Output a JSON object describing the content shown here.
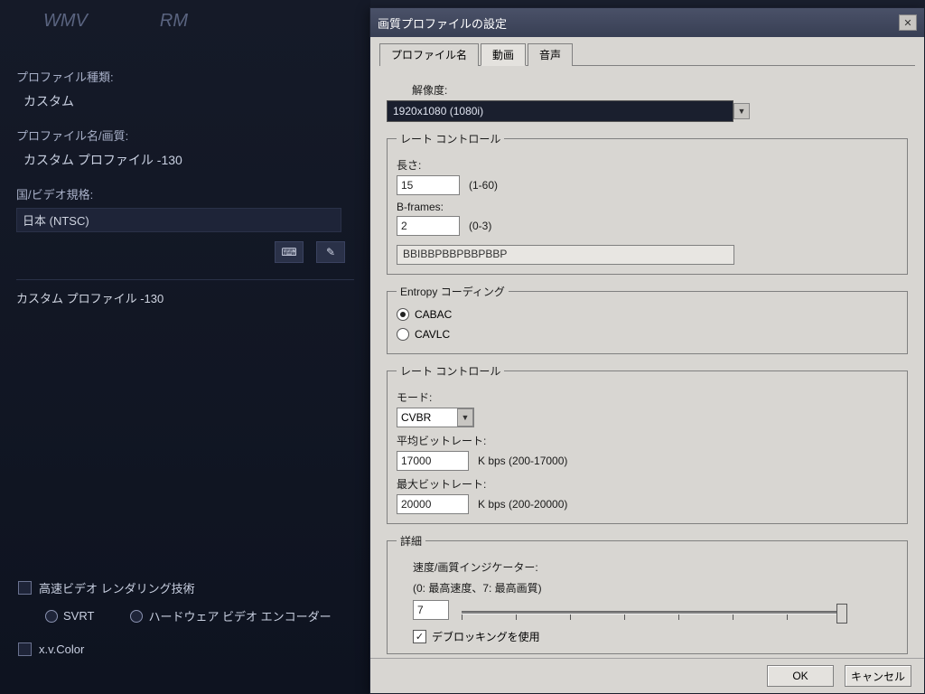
{
  "left": {
    "formats": {
      "wmv": "WMV",
      "rm": "RM"
    },
    "labels": {
      "profile_type": "プロファイル種類:",
      "profile_name": "プロファイル名/画質:",
      "country": "国/ビデオ規格:",
      "fast_render": "高速ビデオ レンダリング技術",
      "svrt": "SVRT",
      "hw_encoder": "ハードウェア ビデオ エンコーダー",
      "xvcolor": "x.v.Color"
    },
    "values": {
      "profile_type": "カスタム",
      "profile_name": "カスタム プロファイル -130",
      "country": "日本 (NTSC)",
      "list_item": "カスタム プロファイル -130"
    }
  },
  "dialog": {
    "title": "画質プロファイルの設定",
    "tabs": {
      "profile": "プロファイル名",
      "video": "動画",
      "audio": "音声"
    },
    "resolution": {
      "label": "解像度:",
      "value": "1920x1080 (1080i)"
    },
    "gop": {
      "legend": "レート コントロール",
      "length_label": "長さ:",
      "length_value": "15",
      "length_hint": "(1-60)",
      "bframes_label": "B-frames:",
      "bframes_value": "2",
      "bframes_hint": "(0-3)",
      "pattern": "BBIBBPBBPBBPBBP"
    },
    "entropy": {
      "legend": "Entropy コーディング",
      "cabac": "CABAC",
      "cavlc": "CAVLC"
    },
    "rate": {
      "legend": "レート コントロール",
      "mode_label": "モード:",
      "mode_value": "CVBR",
      "avg_label": "平均ビットレート:",
      "avg_value": "17000",
      "avg_hint": "K bps (200-17000)",
      "max_label": "最大ビットレート:",
      "max_value": "20000",
      "max_hint": "K bps (200-20000)"
    },
    "advanced": {
      "legend": "詳細",
      "indicator_label": "速度/画質インジケーター:",
      "indicator_hint": "(0: 最高速度、7: 最高画質)",
      "indicator_value": "7",
      "deblock": "デブロッキングを使用"
    },
    "buttons": {
      "ok": "OK",
      "cancel": "キャンセル"
    }
  }
}
